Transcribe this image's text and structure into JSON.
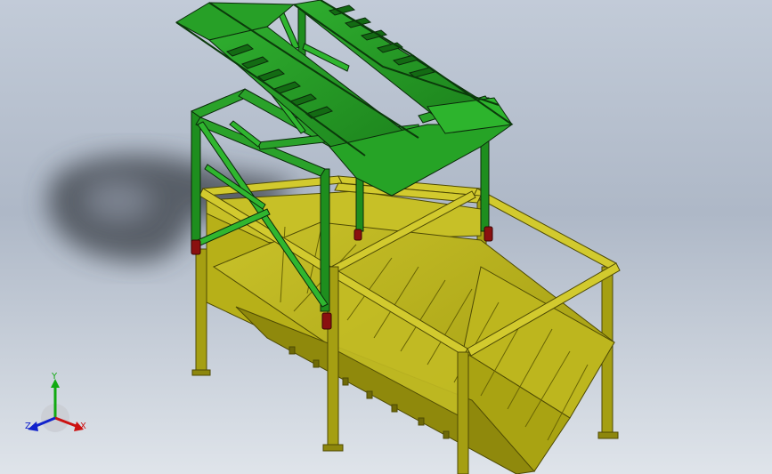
{
  "viewport": {
    "background_top": "#c2cbd8",
    "background_bottom": "#dfe4ea",
    "model_colors": {
      "platform_green": "#1f8f1f",
      "platform_green_light": "#2ea82e",
      "edge_dark": "#0b2a0b",
      "hopper_olive": "#b7b018",
      "hopper_olive_dark": "#7d7708",
      "support_red": "#8a1010",
      "shadow": "#3b3f47"
    }
  },
  "triad": {
    "x_label": "X",
    "y_label": "Y",
    "z_label": "Z",
    "x_color": "#cc1111",
    "y_color": "#11aa11",
    "z_color": "#1122cc"
  }
}
